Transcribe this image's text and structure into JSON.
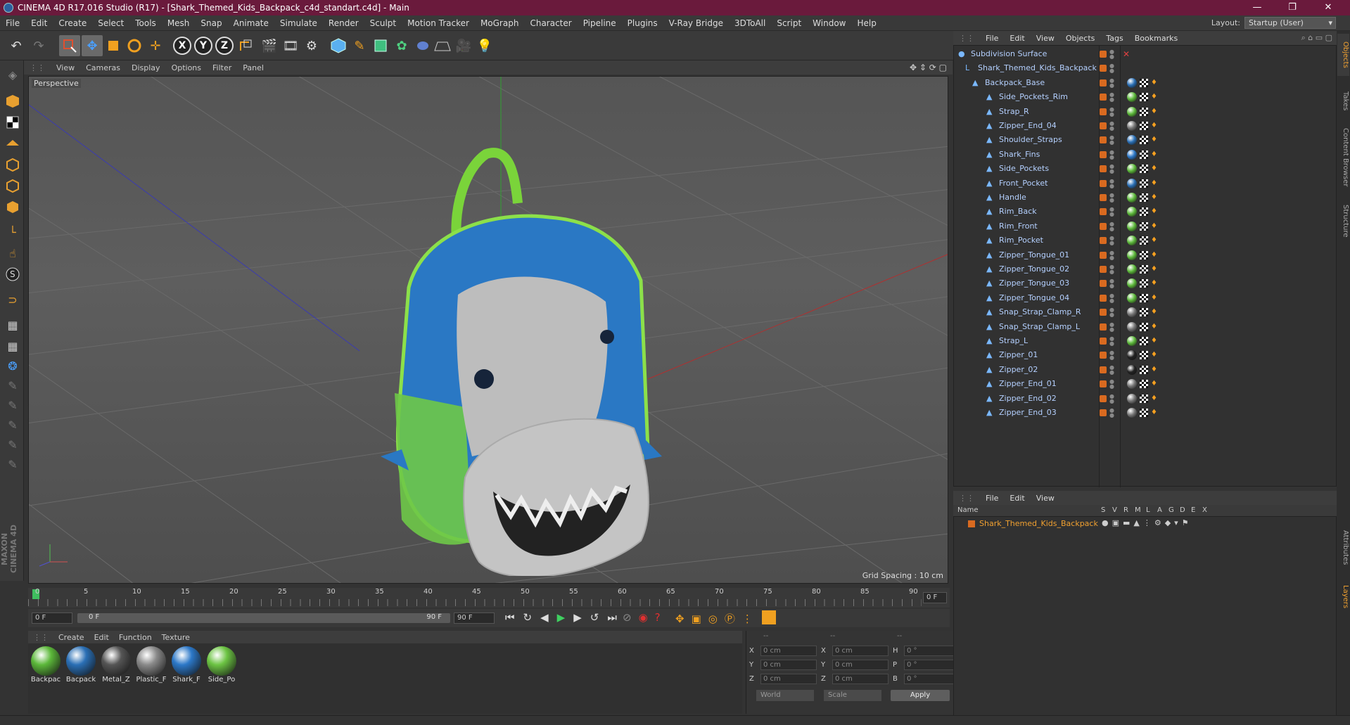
{
  "window": {
    "title": "CINEMA 4D R17.016 Studio (R17) - [Shark_Themed_Kids_Backpack_c4d_standart.c4d] - Main",
    "min": "—",
    "max": "❐",
    "close": "✕"
  },
  "menu": [
    "File",
    "Edit",
    "Create",
    "Select",
    "Tools",
    "Mesh",
    "Snap",
    "Animate",
    "Simulate",
    "Render",
    "Sculpt",
    "Motion Tracker",
    "MoGraph",
    "Character",
    "Pipeline",
    "Plugins",
    "V-Ray Bridge",
    "3DToAll",
    "Script",
    "Window",
    "Help"
  ],
  "layout": {
    "label": "Layout:",
    "value": "Startup (User)"
  },
  "viewport": {
    "menu": [
      "View",
      "Cameras",
      "Display",
      "Options",
      "Filter",
      "Panel"
    ],
    "camera_label": "Perspective",
    "grid_spacing": "Grid Spacing : 10 cm"
  },
  "timeline": {
    "ticks": [
      "0",
      "5",
      "10",
      "15",
      "20",
      "25",
      "30",
      "35",
      "40",
      "45",
      "50",
      "55",
      "60",
      "65",
      "70",
      "75",
      "80",
      "85",
      "90"
    ],
    "current_frame": "0 F",
    "start_field": "0 F",
    "range_start": "0 F",
    "range_end": "90 F",
    "end_field": "90 F"
  },
  "materials": {
    "menu": [
      "Create",
      "Edit",
      "Function",
      "Texture"
    ],
    "items": [
      {
        "label": "Backpac",
        "color": "#5cb83a"
      },
      {
        "label": "Bacpack",
        "color": "#2a6fb5"
      },
      {
        "label": "Metal_Z",
        "color": "#555555"
      },
      {
        "label": "Plastic_F",
        "color": "#8a8a8a"
      },
      {
        "label": "Shark_F",
        "color": "#2c78c8"
      },
      {
        "label": "Side_Po",
        "color": "#6cc443"
      }
    ]
  },
  "coords": {
    "header": [
      "--",
      "--",
      "--"
    ],
    "rows": [
      {
        "a": "X",
        "av": "0 cm",
        "b": "X",
        "bv": "0 cm",
        "c": "H",
        "cv": "0 °"
      },
      {
        "a": "Y",
        "av": "0 cm",
        "b": "Y",
        "bv": "0 cm",
        "c": "P",
        "cv": "0 °"
      },
      {
        "a": "Z",
        "av": "0 cm",
        "b": "Z",
        "bv": "0 cm",
        "c": "B",
        "cv": "0 °"
      }
    ],
    "world": "World",
    "scale": "Scale",
    "apply": "Apply"
  },
  "objects": {
    "menu": [
      "File",
      "Edit",
      "View",
      "Objects",
      "Tags",
      "Bookmarks"
    ],
    "items": [
      {
        "name": "Subdivision Surface",
        "depth": 0,
        "tag": ""
      },
      {
        "name": "Shark_Themed_Kids_Backpack",
        "depth": 1,
        "tag": ""
      },
      {
        "name": "Backpack_Base",
        "depth": 2,
        "tag": "#2a6fb5"
      },
      {
        "name": "Side_Pockets_Rim",
        "depth": 3,
        "tag": "#5cb83a"
      },
      {
        "name": "Strap_R",
        "depth": 3,
        "tag": "#5cb83a"
      },
      {
        "name": "Zipper_End_04",
        "depth": 3,
        "tag": "#777777"
      },
      {
        "name": "Shoulder_Straps",
        "depth": 3,
        "tag": "#2a6fb5"
      },
      {
        "name": "Shark_Fins",
        "depth": 3,
        "tag": "#2c78c8"
      },
      {
        "name": "Side_Pockets",
        "depth": 3,
        "tag": "#5cb83a"
      },
      {
        "name": "Front_Pocket",
        "depth": 3,
        "tag": "#2a6fb5"
      },
      {
        "name": "Handle",
        "depth": 3,
        "tag": "#5cb83a"
      },
      {
        "name": "Rim_Back",
        "depth": 3,
        "tag": "#5cb83a"
      },
      {
        "name": "Rim_Front",
        "depth": 3,
        "tag": "#5cb83a"
      },
      {
        "name": "Rim_Pocket",
        "depth": 3,
        "tag": "#5cb83a"
      },
      {
        "name": "Zipper_Tongue_01",
        "depth": 3,
        "tag": "#5cb83a"
      },
      {
        "name": "Zipper_Tongue_02",
        "depth": 3,
        "tag": "#5cb83a"
      },
      {
        "name": "Zipper_Tongue_03",
        "depth": 3,
        "tag": "#5cb83a"
      },
      {
        "name": "Zipper_Tongue_04",
        "depth": 3,
        "tag": "#5cb83a"
      },
      {
        "name": "Snap_Strap_Clamp_R",
        "depth": 3,
        "tag": "#777777"
      },
      {
        "name": "Snap_Strap_Clamp_L",
        "depth": 3,
        "tag": "#777777"
      },
      {
        "name": "Strap_L",
        "depth": 3,
        "tag": "#5cb83a"
      },
      {
        "name": "Zipper_01",
        "depth": 3,
        "tag": "#222222"
      },
      {
        "name": "Zipper_02",
        "depth": 3,
        "tag": "#222222"
      },
      {
        "name": "Zipper_End_01",
        "depth": 3,
        "tag": "#777777"
      },
      {
        "name": "Zipper_End_02",
        "depth": 3,
        "tag": "#777777"
      },
      {
        "name": "Zipper_End_03",
        "depth": 3,
        "tag": "#777777"
      }
    ]
  },
  "layers": {
    "menu": [
      "File",
      "Edit",
      "View"
    ],
    "columns": [
      "Name",
      "S",
      "V",
      "R",
      "M",
      "L",
      "A",
      "G",
      "D",
      "E",
      "X"
    ],
    "items": [
      {
        "name": "Shark_Themed_Kids_Backpack",
        "color": "#d96a20"
      }
    ]
  },
  "right_tabs": [
    "Objects",
    "Takes",
    "Content Browser",
    "Structure",
    "Attributes",
    "Layers"
  ],
  "brand": "MAXON CINEMA 4D",
  "axes": [
    "X",
    "Y",
    "Z"
  ]
}
